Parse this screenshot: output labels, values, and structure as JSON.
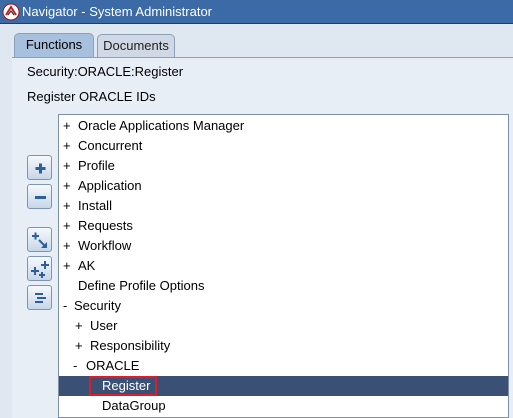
{
  "window": {
    "title": "Navigator - System Administrator"
  },
  "tabs": [
    {
      "label": "Functions",
      "active": true
    },
    {
      "label": "Documents",
      "active": false
    }
  ],
  "path_label": "Security:ORACLE:Register",
  "sub_label": "Register ORACLE IDs",
  "toolbar": [
    {
      "icon": "expand-plus-icon"
    },
    {
      "icon": "collapse-minus-icon"
    },
    {
      "icon": "expand-branch-icon"
    },
    {
      "icon": "expand-all-icon"
    },
    {
      "icon": "collapse-all-icon"
    }
  ],
  "tree": [
    {
      "expander": "+",
      "label": "Oracle Applications Manager",
      "level": 0
    },
    {
      "expander": "+",
      "label": "Concurrent",
      "level": 0
    },
    {
      "expander": "+",
      "label": "Profile",
      "level": 0
    },
    {
      "expander": "+",
      "label": "Application",
      "level": 0
    },
    {
      "expander": "+",
      "label": "Install",
      "level": 0
    },
    {
      "expander": "+",
      "label": "Requests",
      "level": 0
    },
    {
      "expander": "+",
      "label": "Workflow",
      "level": 0
    },
    {
      "expander": "+",
      "label": "AK",
      "level": 0
    },
    {
      "expander": "",
      "label": "Define Profile Options",
      "level": 0
    },
    {
      "expander": "-",
      "label": "Security",
      "level": 0
    },
    {
      "expander": "+",
      "label": "User",
      "level": 1
    },
    {
      "expander": "+",
      "label": "Responsibility",
      "level": 1
    },
    {
      "expander": "-",
      "label": "ORACLE",
      "level": 1
    },
    {
      "expander": "",
      "label": "Register",
      "level": 2,
      "selected": true
    },
    {
      "expander": "",
      "label": "DataGroup",
      "level": 2
    }
  ],
  "colors": {
    "title_bar": "#3b6aa6",
    "selection": "#3b5075",
    "highlight_box": "#e11b2a"
  }
}
